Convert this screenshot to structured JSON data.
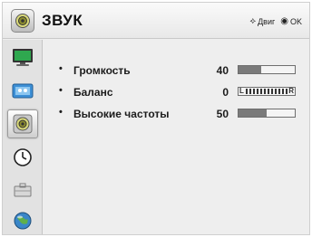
{
  "header": {
    "icon": "speaker-icon",
    "title": "ЗВУК",
    "hints": [
      {
        "icon": "navigation-arrows-icon",
        "glyph": "⟡",
        "label": "Двиг"
      },
      {
        "icon": "ok-button-icon",
        "glyph": "◉",
        "label": "OK"
      }
    ]
  },
  "sidebar": {
    "items": [
      {
        "name": "picture",
        "icon": "tv-picture-icon",
        "active": false
      },
      {
        "name": "channels",
        "icon": "antenna-icon",
        "active": false
      },
      {
        "name": "sound",
        "icon": "speaker-icon",
        "active": true
      },
      {
        "name": "time",
        "icon": "clock-icon",
        "active": false
      },
      {
        "name": "lock",
        "icon": "lock-icon",
        "active": false
      },
      {
        "name": "options",
        "icon": "globe-icon",
        "active": false
      }
    ]
  },
  "settings": [
    {
      "bullet": "•",
      "label": "Громкость",
      "value": "40",
      "level": 0.4
    },
    {
      "bullet": "•",
      "label": "Баланс",
      "value": "0",
      "balance": {
        "left": "L",
        "right": "R",
        "position": 0
      }
    },
    {
      "bullet": "•",
      "label": "Высокие частоты",
      "value": "50",
      "level": 0.5
    }
  ],
  "colors": {
    "background": "#eeeeee",
    "bar_fill": "#7a7a7a",
    "tv_screen": "#2fa84f",
    "header": "#f2f2f2"
  }
}
